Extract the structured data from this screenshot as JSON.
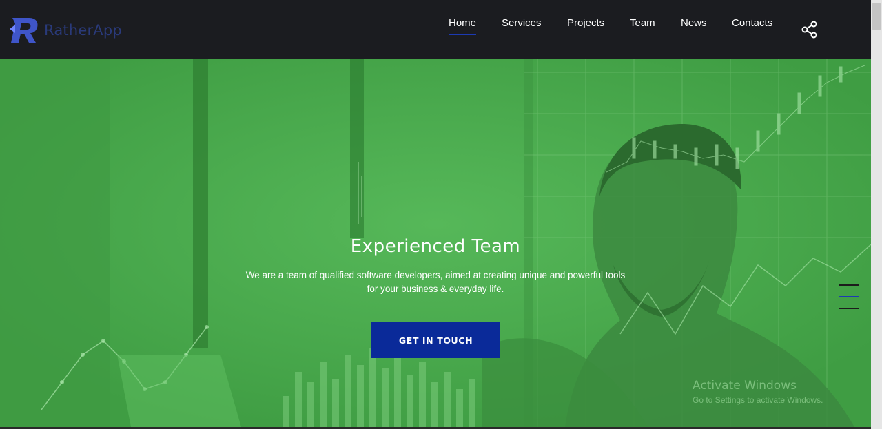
{
  "brand": {
    "name": "RatherApp",
    "logo_color": "#4a5fd6"
  },
  "nav": {
    "items": [
      {
        "label": "Home",
        "active": true
      },
      {
        "label": "Services"
      },
      {
        "label": "Projects"
      },
      {
        "label": "Team"
      },
      {
        "label": "News"
      },
      {
        "label": "Contacts"
      }
    ],
    "share_icon": "share-icon",
    "active_color": "#1c3ab3"
  },
  "hero": {
    "title": "Experienced Team",
    "subtitle_line1": "We are a team of qualified software developers, aimed at creating unique and powerful tools",
    "subtitle_line2": "for your business & everyday life.",
    "cta_label": "GET IN TOUCH",
    "overlay_color": "#4aab4d",
    "cta_color": "#0a2a99"
  },
  "menu_toggle": {
    "icon": "hamburger-menu-icon"
  },
  "watermark": {
    "title": "Activate Windows",
    "subtitle": "Go to Settings to activate Windows."
  }
}
